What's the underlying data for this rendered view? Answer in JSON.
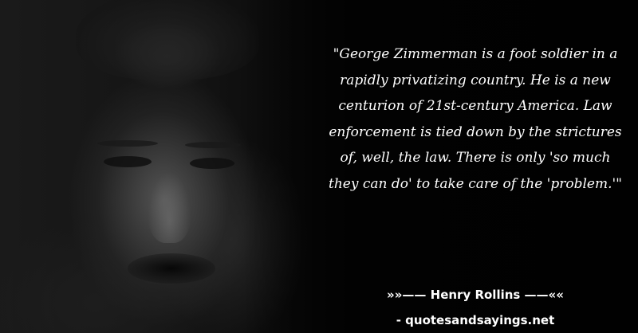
{
  "quote": {
    "text": "\"George Zimmerman is a foot soldier in a rapidly privatizing country. He is a new centurion of 21st-century America. Law enforcement is tied down by the strictures of, well, the law. There is only 'so much they can do' to take care of the 'problem.'\""
  },
  "attribution": {
    "author": "»»—— Henry Rollins ——««",
    "website": "- quotesandsayings.net"
  },
  "colors": {
    "background": "#050505",
    "text": "#ffffff"
  }
}
